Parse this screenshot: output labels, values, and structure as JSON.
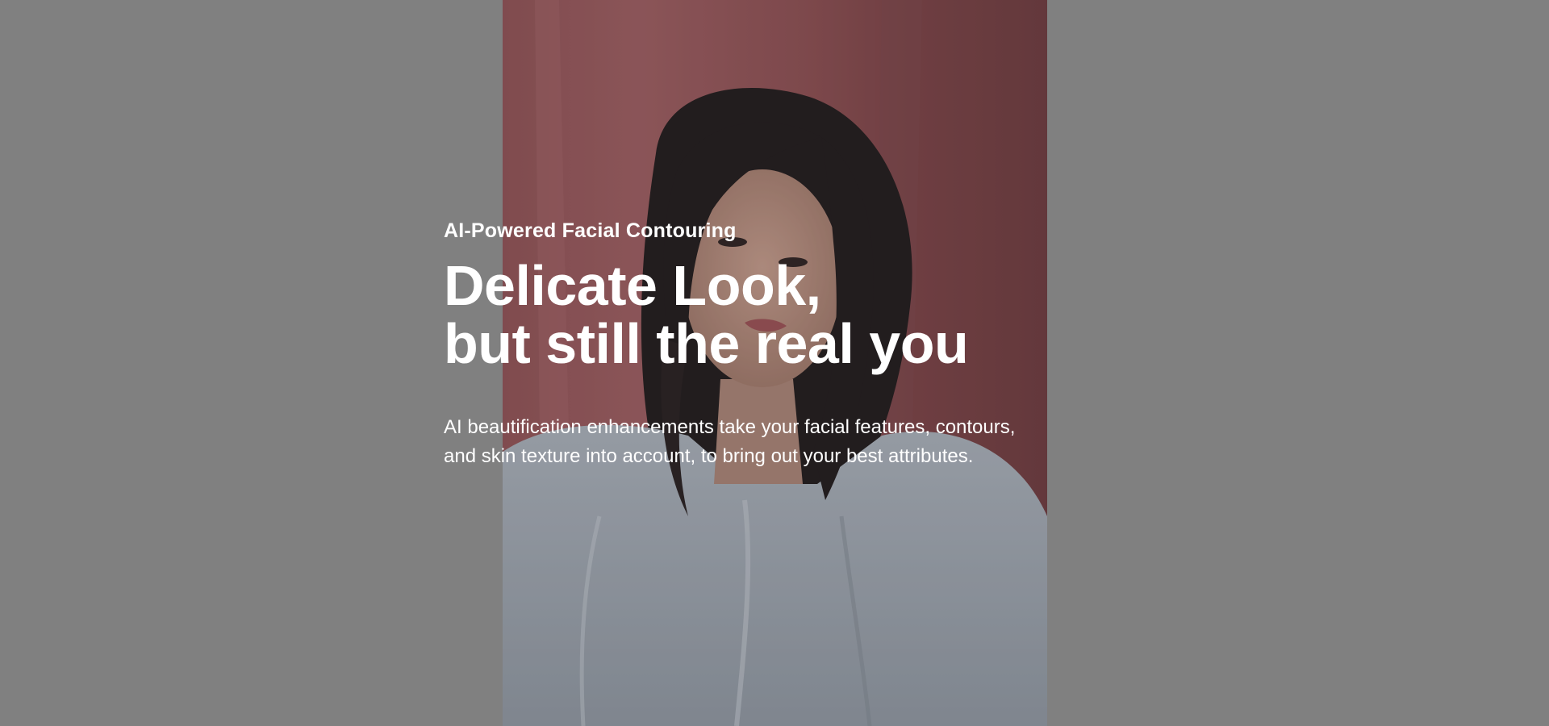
{
  "hero": {
    "eyebrow": "AI-Powered Facial Contouring",
    "headline_line1": "Delicate Look,",
    "headline_line2": "but still the real you",
    "description_line1": "AI beautification enhancements take your facial features, contours,",
    "description_line2": "and skin texture into account, to bring out your best attributes."
  },
  "photo": {
    "subject": "portrait-photo"
  },
  "colors": {
    "page_background": "#808080",
    "backdrop": "#b7676a",
    "text": "#ffffff"
  }
}
